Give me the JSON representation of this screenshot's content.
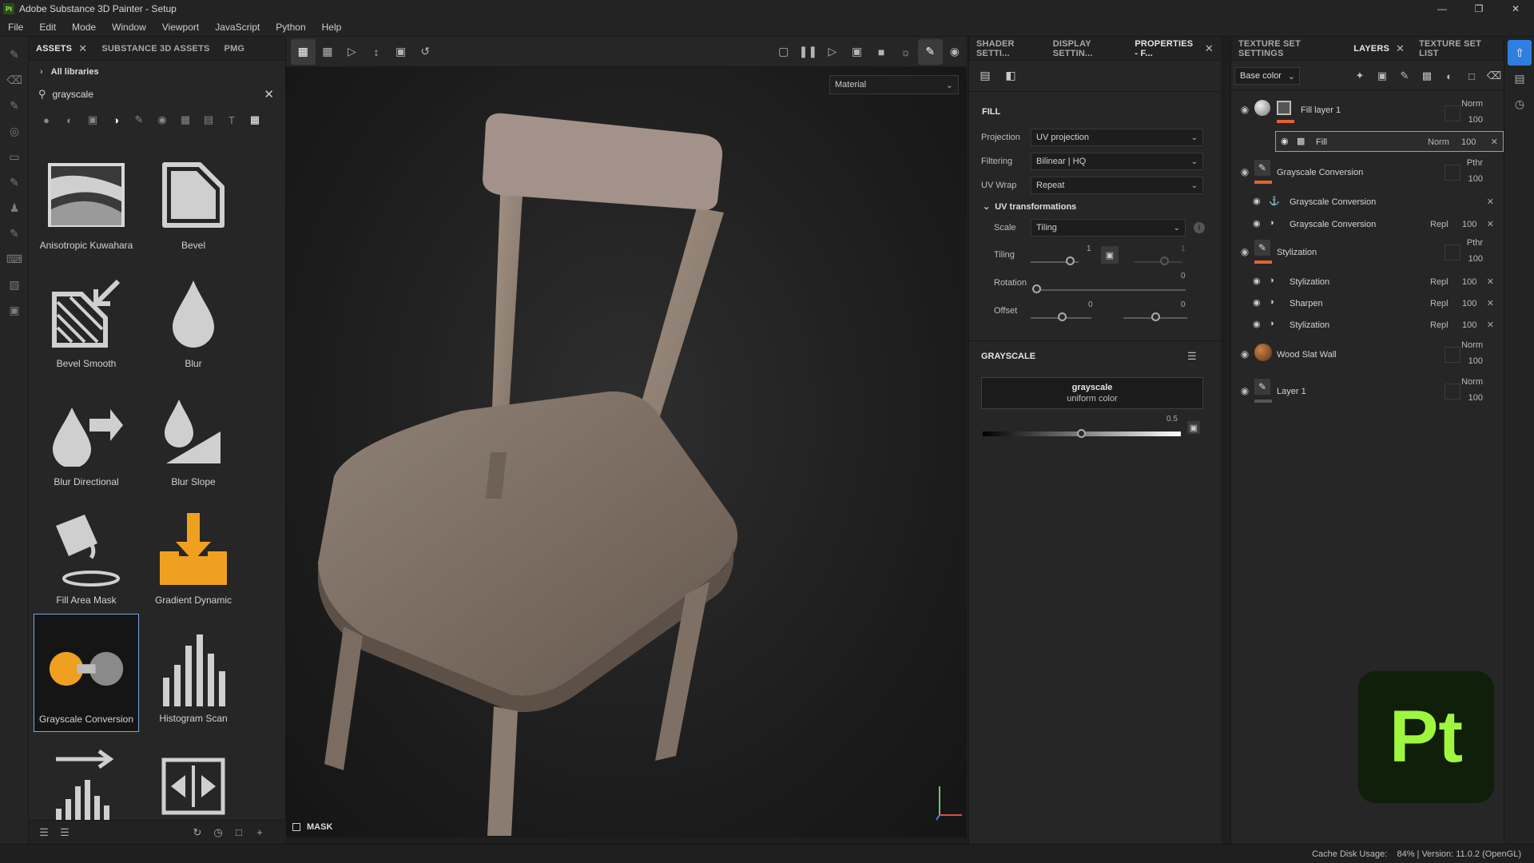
{
  "window": {
    "title": "Adobe Substance 3D Painter - Setup",
    "logo_text": "Pt"
  },
  "menu": [
    "File",
    "Edit",
    "Mode",
    "Window",
    "Viewport",
    "JavaScript",
    "Python",
    "Help"
  ],
  "assets": {
    "tabs": [
      "ASSETS",
      "SUBSTANCE 3D ASSETS",
      "PMG"
    ],
    "library": "All libraries",
    "search_value": "grayscale",
    "items": [
      "Anisotropic Kuwahara",
      "Bevel",
      "Bevel Smooth",
      "Blur",
      "Blur Directional",
      "Blur Slope",
      "Fill Area Mask",
      "Gradient Dynamic",
      "Grayscale Conversion",
      "Histogram Scan"
    ],
    "selected": "Grayscale Conversion"
  },
  "viewport": {
    "material_select": "Material",
    "mask_label": "MASK"
  },
  "properties": {
    "tabs": [
      "SHADER SETTI...",
      "DISPLAY SETTIN...",
      "PROPERTIES - F..."
    ],
    "fill_title": "FILL",
    "projection_label": "Projection",
    "projection_value": "UV projection",
    "filtering_label": "Filtering",
    "filtering_value": "Bilinear | HQ",
    "uvwrap_label": "UV Wrap",
    "uvwrap_value": "Repeat",
    "uvtrans_label": "UV transformations",
    "scale_label": "Scale",
    "scale_value": "Tiling",
    "tiling_label": "Tiling",
    "tiling_value": "1",
    "tiling_value2": "1",
    "rotation_label": "Rotation",
    "rotation_value": "0",
    "offset_label": "Offset",
    "offset_x": "0",
    "offset_y": "0",
    "grayscale_title": "GRAYSCALE",
    "grayscale_name": "grayscale",
    "grayscale_sub": "uniform color",
    "grayscale_value": "0.5",
    "grayscale_level": 0.5
  },
  "layers": {
    "tabs": [
      "TEXTURE SET SETTINGS",
      "LAYERS",
      "TEXTURE SET LIST"
    ],
    "channel": "Base color",
    "rows": [
      {
        "name": "Fill layer 1",
        "blend": "Norm",
        "opacity": "100"
      },
      {
        "name": "Fill",
        "blend": "Norm",
        "opacity": "100"
      },
      {
        "name": "Grayscale Conversion",
        "blend": "Pthr",
        "opacity": "100"
      },
      {
        "name": "Grayscale Conversion",
        "blend": "",
        "opacity": ""
      },
      {
        "name": "Grayscale Conversion",
        "blend": "Repl",
        "opacity": "100"
      },
      {
        "name": "Stylization",
        "blend": "Pthr",
        "opacity": "100"
      },
      {
        "name": "Stylization",
        "blend": "Repl",
        "opacity": "100"
      },
      {
        "name": "Sharpen",
        "blend": "Repl",
        "opacity": "100"
      },
      {
        "name": "Stylization",
        "blend": "Repl",
        "opacity": "100"
      },
      {
        "name": "Wood Slat Wall",
        "blend": "Norm",
        "opacity": "100"
      },
      {
        "name": "Layer 1",
        "blend": "Norm",
        "opacity": "100"
      }
    ]
  },
  "status": {
    "text": "Cache Disk Usage:    84% | Version: 11.0.2 (OpenGL)"
  },
  "colors": {
    "accent_orange": "#e3632c",
    "selection_blue": "#7aa6d8",
    "pt_green": "#9ff63f"
  }
}
